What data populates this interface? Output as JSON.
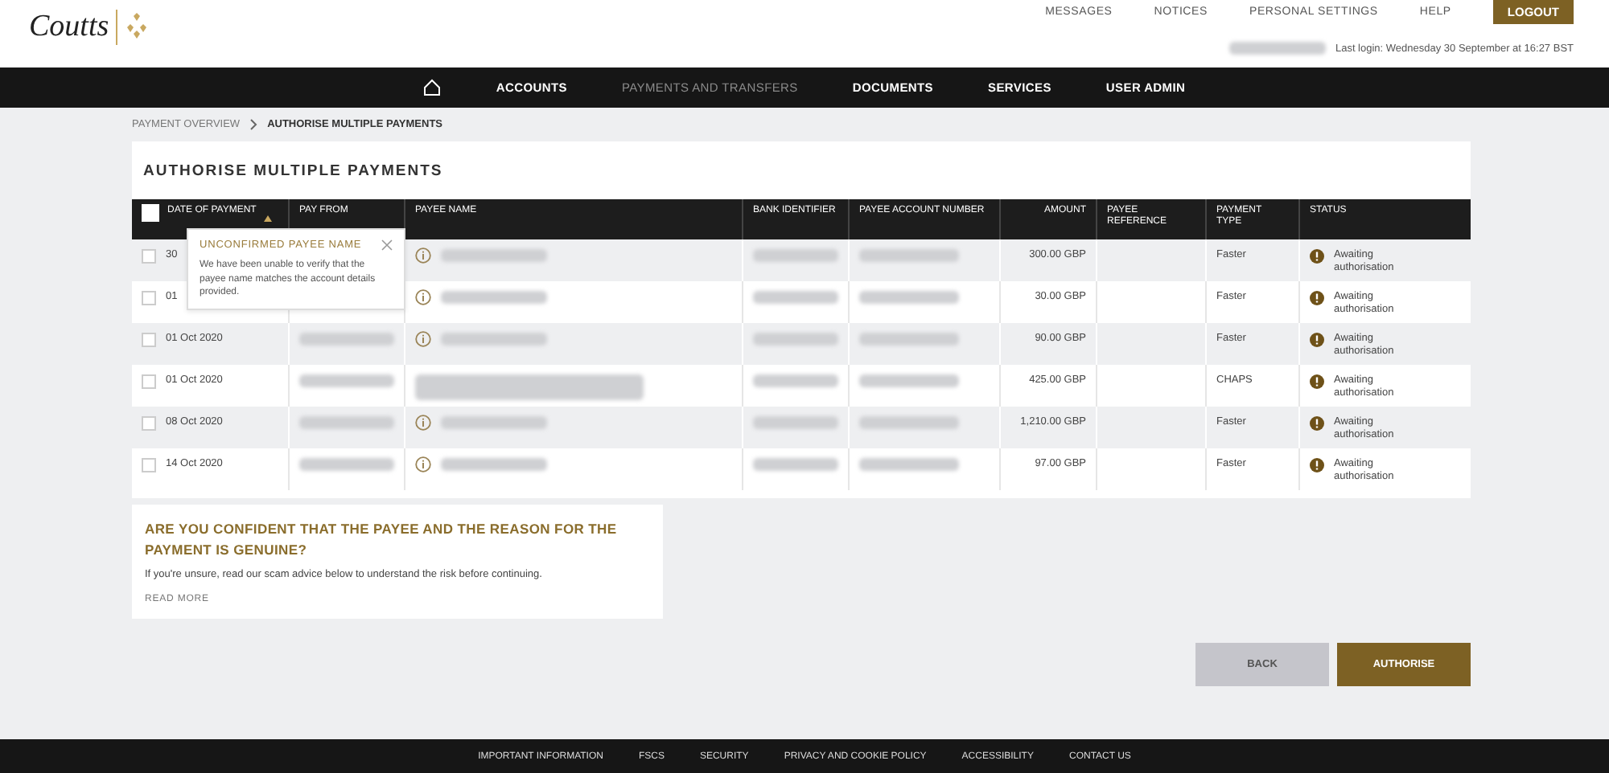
{
  "header": {
    "logo": "Coutts",
    "links": [
      "MESSAGES",
      "NOTICES",
      "PERSONAL SETTINGS",
      "HELP"
    ],
    "logout": "LOGOUT",
    "last_login": "Last login: Wednesday 30 September at 16:27 BST"
  },
  "nav": {
    "items": [
      {
        "label": "ACCOUNTS",
        "selected": false
      },
      {
        "label": "PAYMENTS AND TRANSFERS",
        "selected": true
      },
      {
        "label": "DOCUMENTS",
        "selected": false
      },
      {
        "label": "SERVICES",
        "selected": false
      },
      {
        "label": "USER ADMIN",
        "selected": false
      }
    ]
  },
  "breadcrumb": [
    "PAYMENT OVERVIEW",
    "AUTHORISE MULTIPLE PAYMENTS"
  ],
  "title": "AUTHORISE MULTIPLE PAYMENTS",
  "table": {
    "columns": [
      "DATE OF PAYMENT",
      "PAY FROM",
      "PAYEE NAME",
      "BANK IDENTIFIER",
      "PAYEE ACCOUNT NUMBER",
      "AMOUNT",
      "PAYEE REFERENCE",
      "PAYMENT TYPE",
      "STATUS"
    ],
    "all_checked": false,
    "rows": [
      {
        "checked": false,
        "date": "30",
        "unconfirmed": true,
        "amount": "300.00 GBP",
        "type": "Faster",
        "status": "Awaiting authorisation"
      },
      {
        "checked": false,
        "date": "01",
        "unconfirmed": true,
        "amount": "30.00 GBP",
        "type": "Faster",
        "status": "Awaiting authorisation"
      },
      {
        "checked": false,
        "date": "01 Oct 2020",
        "unconfirmed": true,
        "amount": "90.00 GBP",
        "type": "Faster",
        "status": "Awaiting authorisation"
      },
      {
        "checked": false,
        "date": "01 Oct 2020",
        "unconfirmed": false,
        "amount": "425.00 GBP",
        "type": "CHAPS",
        "status": "Awaiting authorisation"
      },
      {
        "checked": false,
        "date": "08 Oct 2020",
        "unconfirmed": true,
        "amount": "1,210.00 GBP",
        "type": "Faster",
        "status": "Awaiting authorisation"
      },
      {
        "checked": false,
        "date": "14 Oct 2020",
        "unconfirmed": true,
        "amount": "97.00 GBP",
        "type": "Faster",
        "status": "Awaiting authorisation"
      }
    ]
  },
  "tooltip": {
    "title": "UNCONFIRMED PAYEE NAME",
    "text": "We have been unable to verify that the payee name matches the account details provided."
  },
  "warning": {
    "title": "ARE YOU CONFIDENT THAT THE PAYEE AND THE REASON FOR THE PAYMENT IS GENUINE?",
    "text": "If you're unsure, read our scam advice below to understand the risk before continuing.",
    "link": "READ MORE"
  },
  "buttons": {
    "back": "BACK",
    "authorise": "AUTHORISE"
  },
  "footer": [
    "IMPORTANT INFORMATION",
    "FSCS",
    "SECURITY",
    "PRIVACY AND COOKIE POLICY",
    "ACCESSIBILITY",
    "CONTACT US"
  ]
}
